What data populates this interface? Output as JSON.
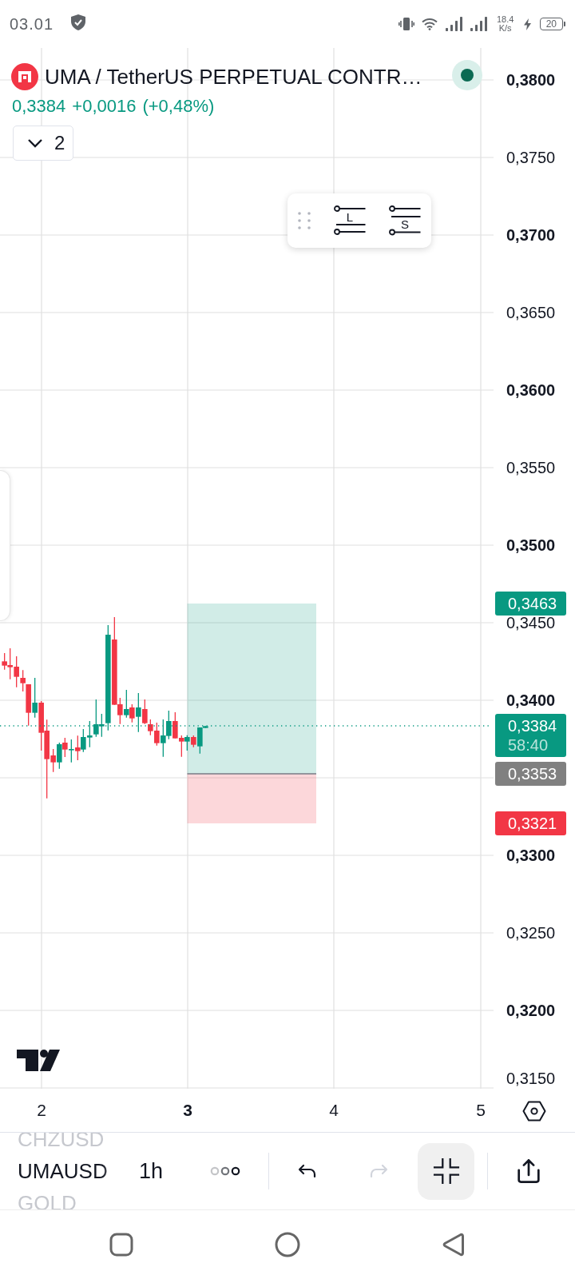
{
  "status_bar": {
    "time": "03.01",
    "network_speed": "18.4",
    "network_speed_unit": "K/s",
    "battery": "20"
  },
  "header": {
    "title": "UMA / TetherUS PERPETUAL CONTR…",
    "price": "0,3384",
    "change": "+0,0016",
    "change_percent": "(+0,48%)",
    "dropdown_button": "2"
  },
  "position_tools": [
    {
      "kind": "long",
      "letter": "L"
    },
    {
      "kind": "short",
      "letter": "S"
    }
  ],
  "price_axis": [
    {
      "label": "0,3800",
      "major": true
    },
    {
      "label": "0,3750",
      "major": false
    },
    {
      "label": "0,3700",
      "major": true
    },
    {
      "label": "0,3650",
      "major": false
    },
    {
      "label": "0,3600",
      "major": true
    },
    {
      "label": "0,3550",
      "major": false
    },
    {
      "label": "0,3500",
      "major": true
    },
    {
      "label": "0,3450",
      "major": false
    },
    {
      "label": "0,3400",
      "major": true
    },
    {
      "label": "0,3300",
      "major": true
    },
    {
      "label": "0,3250",
      "major": false
    },
    {
      "label": "0,3200",
      "major": true
    },
    {
      "label": "0,3150",
      "major": false
    }
  ],
  "price_tags": [
    {
      "price": "0,3463",
      "color": "#089981"
    },
    {
      "price": "0,3384",
      "countdown": "58:40",
      "color": "#089981"
    },
    {
      "price": "0,3353",
      "color": "#808080"
    },
    {
      "price": "0,3321",
      "color": "#f23645"
    }
  ],
  "time_axis": [
    {
      "label": "2",
      "major": false
    },
    {
      "label": "3",
      "major": true
    },
    {
      "label": "4",
      "major": false
    },
    {
      "label": "5",
      "major": false
    }
  ],
  "toolbar": {
    "symbols": [
      {
        "label": "CHZUSD",
        "selected": false
      },
      {
        "label": "UMAUSD",
        "selected": true
      },
      {
        "label": "GOLD",
        "selected": false
      }
    ],
    "interval": "1h",
    "undo": {
      "disabled": false
    },
    "redo": {
      "disabled": true
    },
    "exit_fullscreen": {
      "active": true
    }
  }
}
